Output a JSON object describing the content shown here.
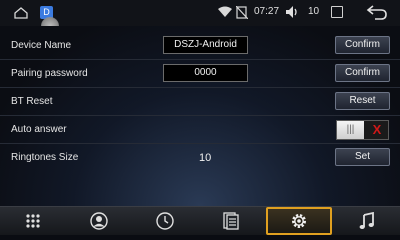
{
  "statusbar": {
    "time": "07:27",
    "volume": "10",
    "app_badge": "D",
    "icons": [
      "home-outline-icon",
      "app-notification-icon",
      "wifi-icon",
      "no-sim-icon",
      "volume-icon",
      "window-icon",
      "back-arrow-icon"
    ]
  },
  "rows": {
    "device_name": {
      "label": "Device Name",
      "value": "DSZJ-Android",
      "button": "Confirm"
    },
    "pairing_password": {
      "label": "Pairing password",
      "value": "0000",
      "button": "Confirm"
    },
    "bt_reset": {
      "label": "BT Reset",
      "button": "Reset"
    },
    "auto_answer": {
      "label": "Auto answer",
      "toggle_on_symbol": "|||",
      "toggle_off_symbol": "X",
      "state": "off"
    },
    "ringtones_size": {
      "label": "Ringtones Size",
      "value": "10",
      "button": "Set"
    }
  },
  "bottom_tabs": [
    {
      "name": "apps-grid-icon"
    },
    {
      "name": "contacts-icon"
    },
    {
      "name": "call-history-icon"
    },
    {
      "name": "phonebook-icon"
    },
    {
      "name": "settings-gear-icon",
      "active": true
    },
    {
      "name": "music-note-icon"
    }
  ],
  "colors": {
    "accent": "#e0a020",
    "toggle_off": "#d01818",
    "background": "#0a0c12"
  }
}
